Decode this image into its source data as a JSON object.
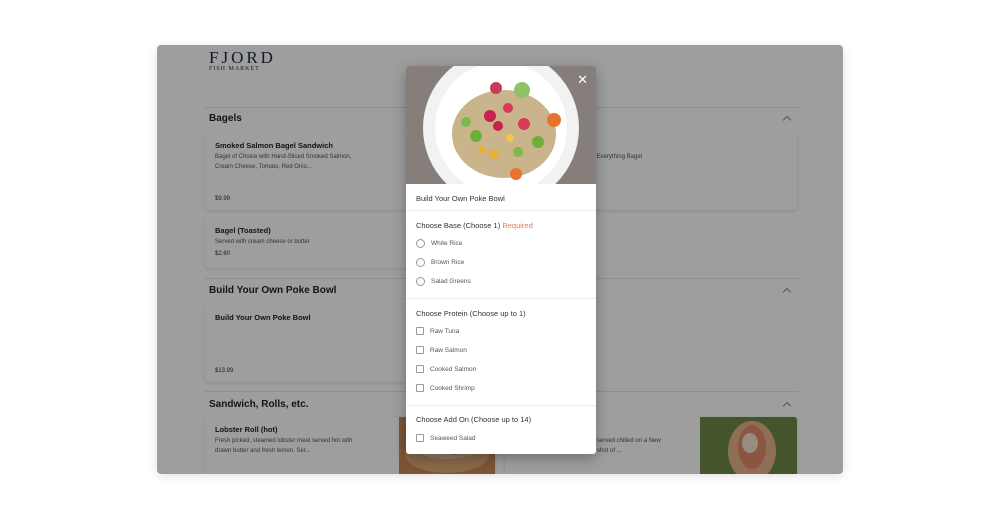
{
  "brand": {
    "name": "FJORD",
    "sub": "FISH MARKET"
  },
  "sections": [
    {
      "title": "Bagels"
    },
    {
      "title": "Build Your Own Poke Bowl"
    },
    {
      "title": "Sandwich, Rolls, etc."
    }
  ],
  "items": {
    "smoked_salmon": {
      "title": "Smoked Salmon Bagel Sandwich",
      "desc1": "Bagel of Choice with Hand-Sliced Smoked Salmon,",
      "desc2": "Cream Cheese, Tomato, Red Onio...",
      "price": "$9.99"
    },
    "everything_bagel": {
      "desc": "r Everything Bagel"
    },
    "bagel_toasted": {
      "title": "Bagel (Toasted)",
      "desc": "Served with cream cheese or butter",
      "price": "$2.60"
    },
    "poke_bowl": {
      "title": "Build Your Own Poke Bowl",
      "price": "$13.99"
    },
    "lobster_roll": {
      "title": "Lobster Roll (hot)",
      "desc1": "Fresh picked, steamed lobster meat served hot with",
      "desc2": "drawn butter and fresh lemon. Ser..."
    },
    "chilled_roll": {
      "desc1": "served chilled on a New",
      "desc2": "shot of ..."
    }
  },
  "modal": {
    "title": "Build Your Own Poke Bowl",
    "close_icon": "close-icon",
    "base": {
      "title": "Choose Base (Choose 1)",
      "required": "Required",
      "options": [
        "White Rice",
        "Brown Rice",
        "Salad Greens"
      ]
    },
    "protein": {
      "title": "Choose Protein (Choose up to 1)",
      "options": [
        "Raw Tuna",
        "Raw Salmon",
        "Cooked Salmon",
        "Cooked Shrimp"
      ]
    },
    "addon": {
      "title": "Choose Add On (Choose up to 14)",
      "options": [
        "Seaweed Salad"
      ]
    }
  },
  "colors": {
    "required": "#e8785c",
    "brand": "#1e2a44"
  }
}
